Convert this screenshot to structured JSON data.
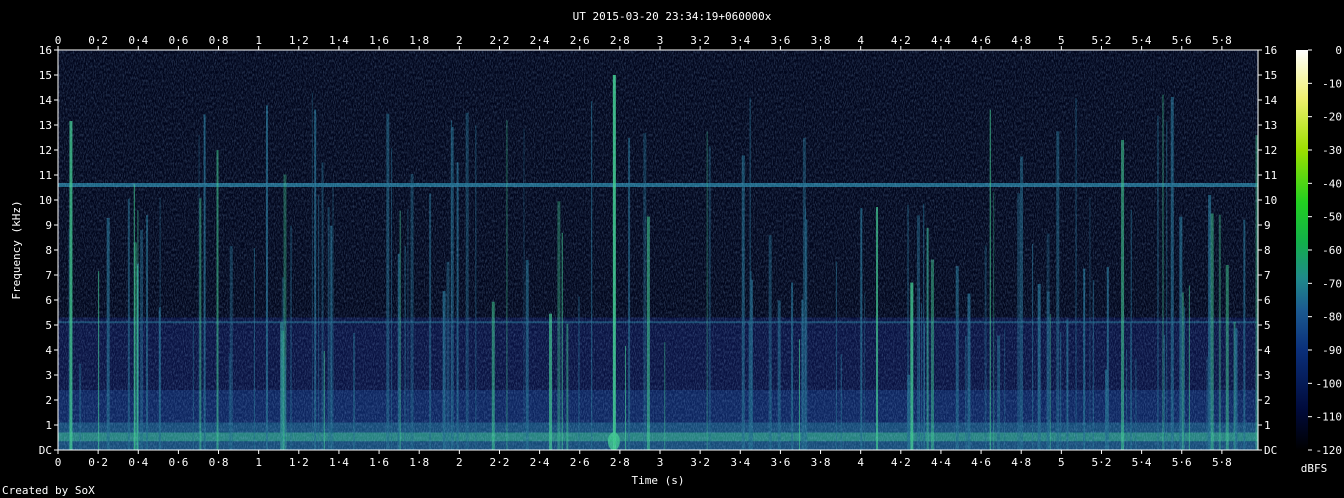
{
  "chart_data": {
    "type": "heatmap",
    "title": "UT 2015-03-20 23:34:19+060000x",
    "xlabel": "Time (s)",
    "ylabel": "Frequency (kHz)",
    "xlim": [
      0,
      5.98
    ],
    "ylim": [
      0,
      16
    ],
    "x_ticks": [
      "0",
      "0·2",
      "0·4",
      "0·6",
      "0·8",
      "1",
      "1·2",
      "1·4",
      "1·6",
      "1·8",
      "2",
      "2·2",
      "2·4",
      "2·6",
      "2·8",
      "3",
      "3·2",
      "3·4",
      "3·6",
      "3·8",
      "4",
      "4·2",
      "4·4",
      "4·6",
      "4·8",
      "5",
      "5·2",
      "5·4",
      "5·6",
      "5·8"
    ],
    "x_tick_values": [
      0,
      0.2,
      0.4,
      0.6,
      0.8,
      1,
      1.2,
      1.4,
      1.6,
      1.8,
      2,
      2.2,
      2.4,
      2.6,
      2.8,
      3,
      3.2,
      3.4,
      3.6,
      3.8,
      4,
      4.2,
      4.4,
      4.6,
      4.8,
      5,
      5.2,
      5.4,
      5.6,
      5.8
    ],
    "y_ticks": [
      "DC",
      "1",
      "2",
      "3",
      "4",
      "5",
      "6",
      "7",
      "8",
      "9",
      "10",
      "11",
      "12",
      "13",
      "14",
      "15",
      "16"
    ],
    "y_tick_values": [
      0,
      1,
      2,
      3,
      4,
      5,
      6,
      7,
      8,
      9,
      10,
      11,
      12,
      13,
      14,
      15,
      16
    ],
    "colorbar": {
      "label": "dBFS",
      "ticks": [
        "0",
        "-10",
        "-20",
        "-30",
        "-40",
        "-50",
        "-60",
        "-70",
        "-80",
        "-90",
        "-100",
        "-110",
        "-120"
      ],
      "tick_values": [
        0,
        -10,
        -20,
        -30,
        -40,
        -50,
        -60,
        -70,
        -80,
        -90,
        -100,
        -110,
        -120
      ],
      "range": [
        -120,
        0
      ]
    },
    "features": {
      "carrier_khz": 10.6,
      "background_dbfs": -100,
      "low_band_dbfs": -85,
      "strongest_event_s": 2.77
    },
    "colors": {
      "background": "#000000",
      "text": "#ffffff",
      "low": "#0a1446",
      "mid": "#1f6b8a",
      "high": "#3cc88a"
    }
  },
  "footer": {
    "credit": "Created by SoX"
  }
}
